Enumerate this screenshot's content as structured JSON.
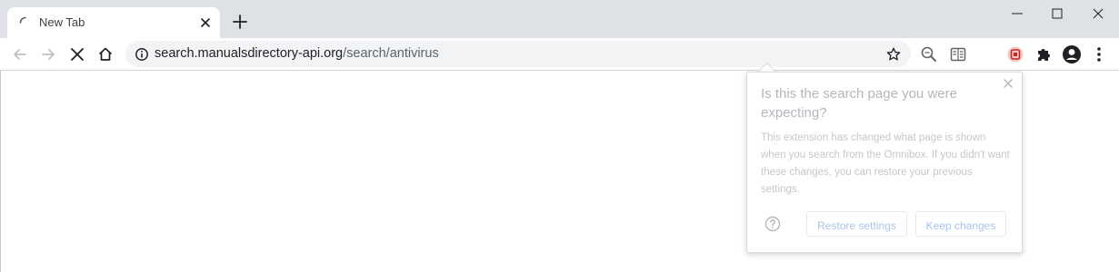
{
  "tabs": [
    {
      "title": "New Tab"
    }
  ],
  "omnibox": {
    "url_host": "search.manualsdirectory-api.org",
    "url_path": "/search/antivirus"
  },
  "bubble": {
    "title": "Is this the search page you were expecting?",
    "body": "This extension has changed what page is shown when you search from the Omnibox. If you didn't want these changes, you can restore your previous settings.",
    "restore_label": "Restore settings",
    "keep_label": "Keep changes"
  },
  "colors": {
    "tabstrip": "#dee1e6",
    "omnibox": "#f1f3f4",
    "button_text": "#a9c4ea",
    "extension_badge": "#c62828"
  },
  "icons": {
    "tab": [
      "loading-spinner-icon",
      "close-icon",
      "plus-icon"
    ],
    "window": [
      "minimize-icon",
      "maximize-icon",
      "close-icon"
    ],
    "toolbar": [
      "back-arrow-icon",
      "forward-arrow-icon",
      "stop-icon",
      "home-icon",
      "info-icon",
      "star-icon",
      "zoom-icon",
      "reader-icon",
      "extension-icon",
      "puzzle-icon",
      "profile-icon",
      "kebab-menu-icon"
    ],
    "bubble": [
      "close-icon",
      "help-icon"
    ]
  }
}
